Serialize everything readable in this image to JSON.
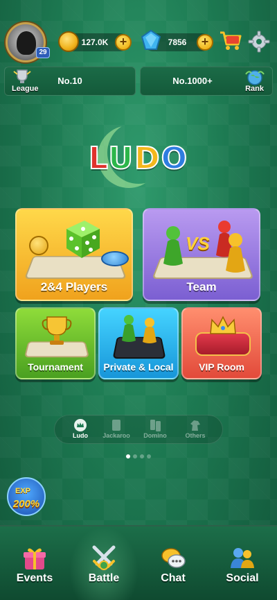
{
  "player": {
    "level": "29"
  },
  "currency": {
    "coins": "127.0K",
    "gems": "7856",
    "plus": "+"
  },
  "rank": {
    "league_label": "League",
    "league_value": "No.10",
    "rank_value": "No.1000+",
    "rank_label": "Rank"
  },
  "logo": {
    "letters": [
      "L",
      "U",
      "D",
      "O"
    ],
    "colors": [
      "#e0322d",
      "#2db64a",
      "#f4b71c",
      "#2f7de0"
    ]
  },
  "modes": {
    "players": "2&4 Players",
    "team": "Team",
    "tournament": "Tournament",
    "private": "Private & Local",
    "vip": "VIP Room",
    "vs": "VS"
  },
  "games": [
    {
      "label": "Ludo",
      "active": true
    },
    {
      "label": "Jackaroo",
      "active": false
    },
    {
      "label": "Domino",
      "active": false
    },
    {
      "label": "Others",
      "active": false
    }
  ],
  "exp_badge": {
    "title": "EXP",
    "value": "200%"
  },
  "nav": {
    "events": "Events",
    "battle": "Battle",
    "chat": "Chat",
    "social": "Social"
  }
}
